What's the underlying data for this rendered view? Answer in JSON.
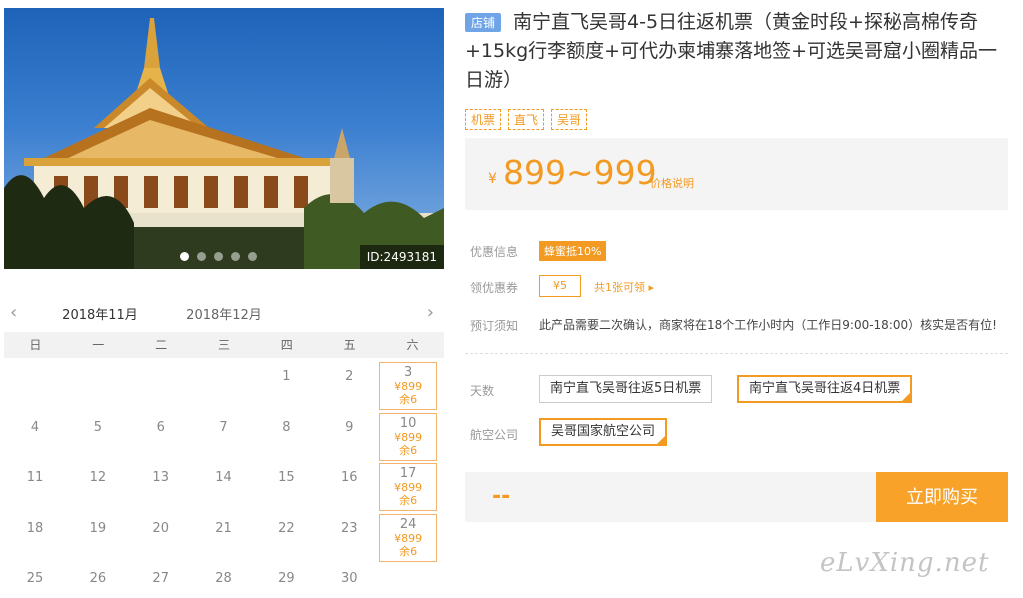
{
  "gallery": {
    "image_id": "ID:2493181",
    "total_slides": 5,
    "active_slide": 1
  },
  "calendar": {
    "prev_arrow": "‹",
    "next_arrow": "›",
    "months": [
      "2018年11月",
      "2018年12月"
    ],
    "active_month": "2018年11月",
    "weekdays": [
      "日",
      "一",
      "二",
      "三",
      "四",
      "五",
      "六"
    ],
    "days": [
      {
        "day": "1",
        "col": 4,
        "row": 0
      },
      {
        "day": "2",
        "col": 5,
        "row": 0
      },
      {
        "day": "3",
        "col": 6,
        "row": 0,
        "price": "¥899",
        "stock": "余6"
      },
      {
        "day": "4",
        "col": 0,
        "row": 1
      },
      {
        "day": "5",
        "col": 1,
        "row": 1
      },
      {
        "day": "6",
        "col": 2,
        "row": 1
      },
      {
        "day": "7",
        "col": 3,
        "row": 1
      },
      {
        "day": "8",
        "col": 4,
        "row": 1
      },
      {
        "day": "9",
        "col": 5,
        "row": 1
      },
      {
        "day": "10",
        "col": 6,
        "row": 1,
        "price": "¥899",
        "stock": "余6"
      },
      {
        "day": "11",
        "col": 0,
        "row": 2
      },
      {
        "day": "12",
        "col": 1,
        "row": 2
      },
      {
        "day": "13",
        "col": 2,
        "row": 2
      },
      {
        "day": "14",
        "col": 3,
        "row": 2
      },
      {
        "day": "15",
        "col": 4,
        "row": 2
      },
      {
        "day": "16",
        "col": 5,
        "row": 2
      },
      {
        "day": "17",
        "col": 6,
        "row": 2,
        "price": "¥899",
        "stock": "余6"
      },
      {
        "day": "18",
        "col": 0,
        "row": 3
      },
      {
        "day": "19",
        "col": 1,
        "row": 3
      },
      {
        "day": "20",
        "col": 2,
        "row": 3
      },
      {
        "day": "21",
        "col": 3,
        "row": 3
      },
      {
        "day": "22",
        "col": 4,
        "row": 3
      },
      {
        "day": "23",
        "col": 5,
        "row": 3
      },
      {
        "day": "24",
        "col": 6,
        "row": 3,
        "price": "¥899",
        "stock": "余6"
      },
      {
        "day": "25",
        "col": 0,
        "row": 4
      },
      {
        "day": "26",
        "col": 1,
        "row": 4
      },
      {
        "day": "27",
        "col": 2,
        "row": 4
      },
      {
        "day": "28",
        "col": 3,
        "row": 4
      },
      {
        "day": "29",
        "col": 4,
        "row": 4
      },
      {
        "day": "30",
        "col": 5,
        "row": 4
      }
    ]
  },
  "product": {
    "shop_badge": "店铺",
    "title": "南宁直飞吴哥4-5日往返机票（黄金时段+探秘高棉传奇+15kg行李额度+可代办柬埔寨落地签+可选吴哥窟小圈精品一日游）",
    "tags": [
      "机票",
      "直飞",
      "吴哥"
    ],
    "price_currency": "¥",
    "price_range": "899~999",
    "price_explain": "价格说明"
  },
  "offers": {
    "discount_label": "优惠信息",
    "discount_badge": "蜂蜜抵10%",
    "coupon_label": "领优惠券",
    "coupon_value": "¥5",
    "coupon_link": "共1张可领 ▸",
    "notice_label": "预订须知",
    "notice_text": "此产品需要二次确认，商家将在18个工作小时内（工作日9:00-18:00）核实是否有位!"
  },
  "options": {
    "days_label": "天数",
    "days_choices": [
      "南宁直飞吴哥往返5日机票",
      "南宁直飞吴哥往返4日机票"
    ],
    "days_selected": "南宁直飞吴哥往返4日机票",
    "airline_label": "航空公司",
    "airline_choices": [
      "吴哥国家航空公司"
    ],
    "airline_selected": "吴哥国家航空公司"
  },
  "purchase": {
    "total_placeholder": "--",
    "buy_label": "立即购买"
  },
  "watermark": "eLvXing.net",
  "colors": {
    "accent": "#f29a22",
    "shop_badge": "#6fa5e7",
    "buy_button": "#f8a22a"
  }
}
